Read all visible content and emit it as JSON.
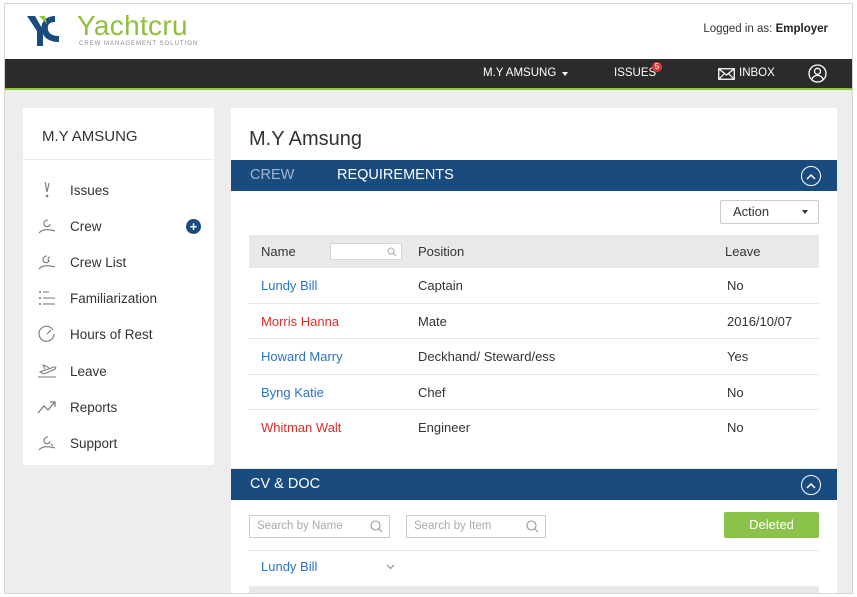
{
  "brand": {
    "name": "Yachtcru",
    "tagline": "CREW MANAGEMENT SOLUTION",
    "logo_icon": "yc-logo-mark",
    "colors": {
      "primary": "#1a4b7e",
      "accent": "#8cc63f",
      "dark": "#2b2b2b"
    }
  },
  "header": {
    "logged_prefix": "Logged in as:",
    "logged_user": "Employer"
  },
  "nav": {
    "vessel": "M.Y AMSUNG",
    "issues": "ISSUES",
    "issues_count": "5",
    "inbox": "INBOX",
    "user_icon": "user-icon"
  },
  "sidebar": {
    "title": "M.Y AMSUNG",
    "items": [
      {
        "label": "Issues",
        "icon": "issues-icon"
      },
      {
        "label": "Crew",
        "icon": "crew-icon",
        "add": "+"
      },
      {
        "label": "Crew List",
        "icon": "crew-list-icon"
      },
      {
        "label": "Familiarization",
        "icon": "list-icon"
      },
      {
        "label": "Hours of Rest",
        "icon": "clock-icon"
      },
      {
        "label": "Leave",
        "icon": "plane-icon"
      },
      {
        "label": "Reports",
        "icon": "trend-icon"
      },
      {
        "label": "Support",
        "icon": "support-icon"
      }
    ]
  },
  "main": {
    "title": "M.Y Amsung",
    "tabs": [
      {
        "label": "CREW"
      },
      {
        "label": "REQUIREMENTS"
      }
    ],
    "action_label": "Action",
    "columns": {
      "name": "Name",
      "position": "Position",
      "leave": "Leave"
    },
    "rows": [
      {
        "name": "Lundy Bill",
        "position": "Captain",
        "leave": "No",
        "status_color": "#2a74c4"
      },
      {
        "name": "Morris Hanna",
        "position": "Mate",
        "leave": "2016/10/07",
        "status_color": "#d9302c"
      },
      {
        "name": "Howard Marry",
        "position": "Deckhand/ Steward/ess",
        "leave": "Yes",
        "status_color": "#2a74c4"
      },
      {
        "name": "Byng Katie",
        "position": "Chef",
        "leave": "No",
        "status_color": "#2a74c4"
      },
      {
        "name": "Whitman Walt",
        "position": "Engineer",
        "leave": "No",
        "status_color": "#d9302c"
      }
    ]
  },
  "cv": {
    "title": "CV & DOC",
    "search_name_placeholder": "Search by Name",
    "search_item_placeholder": "Search by Item",
    "deleted_label": "Deleted",
    "first_row": "Lundy Bill"
  }
}
